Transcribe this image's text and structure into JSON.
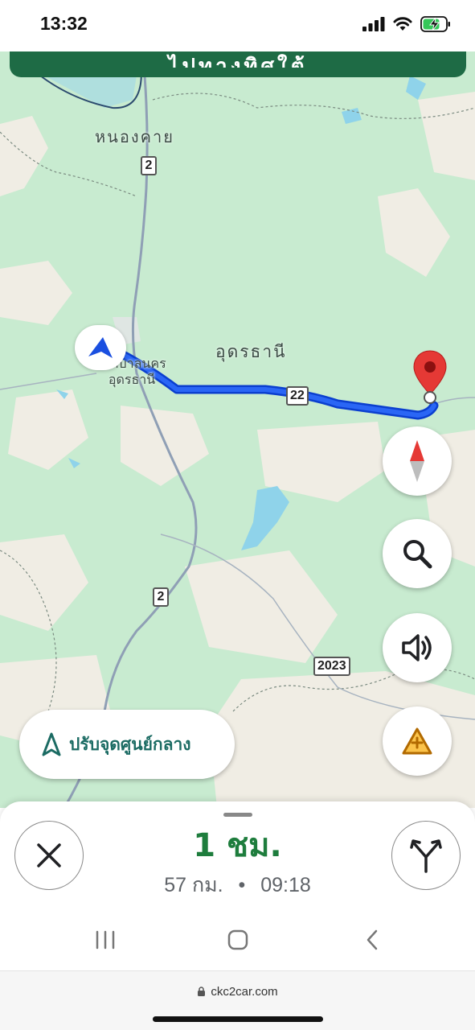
{
  "status_bar": {
    "time": "13:32"
  },
  "nav_banner": {
    "instruction": "ไปทางทิศใต้"
  },
  "map": {
    "labels": {
      "nong_khai": "หนองคาย",
      "udon_thani": "อุดรธานี",
      "city_line1": "เทศบาลนคร",
      "city_line2": "อุดรธานี"
    },
    "road_shields": {
      "route_2_top": "2",
      "route_22": "22",
      "route_2_bottom": "2",
      "route_2023": "2023"
    },
    "colors": {
      "land": "#c8ebd0",
      "route": "#1a4fe0",
      "pin": "#e53935"
    }
  },
  "controls": {
    "compass": "compass-icon",
    "search": "search-icon",
    "sound": "volume-icon",
    "report": "report-incident-icon",
    "recenter_label": "ปรับจุดศูนย์กลาง"
  },
  "trip": {
    "duration": "1 ชม.",
    "distance": "57 กม.",
    "separator": "•",
    "arrival_time": "09:18"
  },
  "browser": {
    "url": "ckc2car.com"
  }
}
